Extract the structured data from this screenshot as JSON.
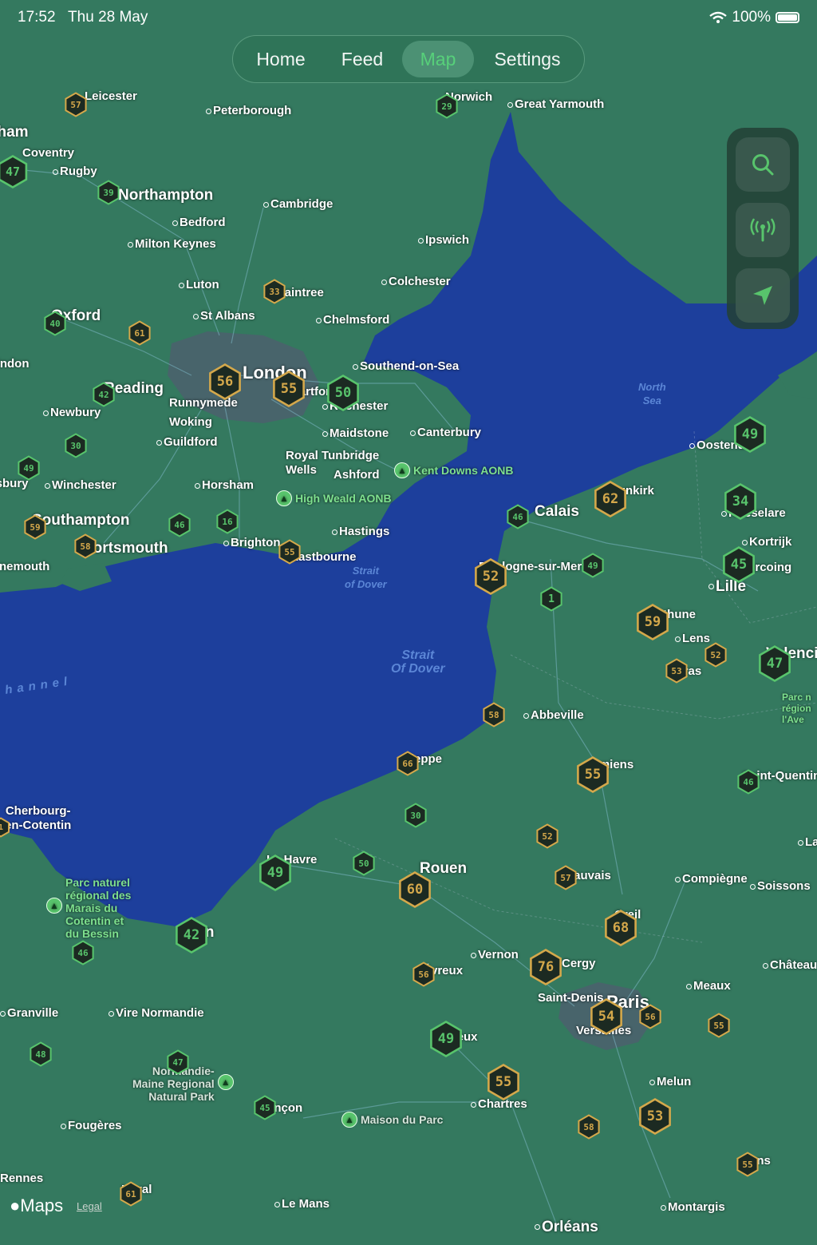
{
  "status_bar": {
    "time": "17:52",
    "date": "Thu 28 May",
    "battery": "100%"
  },
  "nav": {
    "tabs": [
      {
        "label": "Home",
        "active": false
      },
      {
        "label": "Feed",
        "active": false
      },
      {
        "label": "Map",
        "active": true
      },
      {
        "label": "Settings",
        "active": false
      }
    ]
  },
  "map_controls": [
    "search-icon",
    "antenna-icon",
    "location-arrow-icon"
  ],
  "colors": {
    "land": "#34795f",
    "sea": "#1d3f9c",
    "marker_green": "#58c46c",
    "marker_gold": "#d4a84b",
    "marker_fill": "#1c2a22"
  },
  "places": [
    {
      "id": "leicester",
      "name": "Leicester"
    },
    {
      "id": "nottingham",
      "name": "Nottingham"
    },
    {
      "id": "coventry",
      "name": "Coventry"
    },
    {
      "id": "rugby",
      "name": "Rugby"
    },
    {
      "id": "northampton",
      "name": "Northampton"
    },
    {
      "id": "peterborough",
      "name": "Peterborough"
    },
    {
      "id": "norwich",
      "name": "Norwich"
    },
    {
      "id": "great-yarmouth",
      "name": "Great Yarmouth"
    },
    {
      "id": "cambridge",
      "name": "Cambridge"
    },
    {
      "id": "bedford",
      "name": "Bedford"
    },
    {
      "id": "milton-keynes",
      "name": "Milton Keynes"
    },
    {
      "id": "ipswich",
      "name": "Ipswich"
    },
    {
      "id": "luton",
      "name": "Luton"
    },
    {
      "id": "braintree",
      "name": "Braintree"
    },
    {
      "id": "colchester",
      "name": "Colchester"
    },
    {
      "id": "oxford",
      "name": "Oxford"
    },
    {
      "id": "st-albans",
      "name": "St Albans"
    },
    {
      "id": "chelmsford",
      "name": "Chelmsford"
    },
    {
      "id": "swindon",
      "name": "Swindon"
    },
    {
      "id": "london",
      "name": "London"
    },
    {
      "id": "southend",
      "name": "Southend-on-Sea"
    },
    {
      "id": "reading",
      "name": "Reading"
    },
    {
      "id": "runnymede",
      "name": "Runnymede"
    },
    {
      "id": "dartford",
      "name": "Dartford"
    },
    {
      "id": "rochester",
      "name": "Rochester"
    },
    {
      "id": "newbury",
      "name": "Newbury"
    },
    {
      "id": "woking",
      "name": "Woking"
    },
    {
      "id": "maidstone",
      "name": "Maidstone"
    },
    {
      "id": "canterbury",
      "name": "Canterbury"
    },
    {
      "id": "guildford",
      "name": "Guildford"
    },
    {
      "id": "tunbridge-wells",
      "name": "Royal Tunbridge\nWells"
    },
    {
      "id": "ashford",
      "name": "Ashford"
    },
    {
      "id": "salisbury",
      "name": "Salisbury"
    },
    {
      "id": "winchester",
      "name": "Winchester"
    },
    {
      "id": "horsham",
      "name": "Horsham"
    },
    {
      "id": "southampton",
      "name": "Southampton"
    },
    {
      "id": "hastings",
      "name": "Hastings"
    },
    {
      "id": "portsmouth",
      "name": "Portsmouth"
    },
    {
      "id": "brighton",
      "name": "Brighton"
    },
    {
      "id": "eastbourne",
      "name": "Eastbourne"
    },
    {
      "id": "bournemouth",
      "name": "Bournemouth"
    },
    {
      "id": "oostende",
      "name": "Oostende"
    },
    {
      "id": "dunkirk",
      "name": "Dunkirk"
    },
    {
      "id": "calais",
      "name": "Calais"
    },
    {
      "id": "roeselare",
      "name": "Roeselare"
    },
    {
      "id": "kortrijk",
      "name": "Kortrijk"
    },
    {
      "id": "boulogne",
      "name": "Boulogne-sur-Mer"
    },
    {
      "id": "tourcoing",
      "name": "Tourcoing"
    },
    {
      "id": "lille",
      "name": "Lille"
    },
    {
      "id": "bethune",
      "name": "Béthune"
    },
    {
      "id": "lens",
      "name": "Lens"
    },
    {
      "id": "arras",
      "name": "Arras"
    },
    {
      "id": "valenciennes",
      "name": "Valenciennes"
    },
    {
      "id": "abbeville",
      "name": "Abbeville"
    },
    {
      "id": "dieppe",
      "name": "Dieppe"
    },
    {
      "id": "amiens",
      "name": "Amiens"
    },
    {
      "id": "saint-quentin",
      "name": "Saint-Quentin"
    },
    {
      "id": "cherbourg",
      "name": "Cherbourg-\nen-Cotentin"
    },
    {
      "id": "le-havre",
      "name": "Le Havre"
    },
    {
      "id": "rouen",
      "name": "Rouen"
    },
    {
      "id": "beauvais",
      "name": "Beauvais"
    },
    {
      "id": "compiegne",
      "name": "Compiègne"
    },
    {
      "id": "soissons",
      "name": "Soissons"
    },
    {
      "id": "laon",
      "name": "Laon"
    },
    {
      "id": "creil",
      "name": "Creil"
    },
    {
      "id": "caen",
      "name": "Caen"
    },
    {
      "id": "vernon",
      "name": "Vernon"
    },
    {
      "id": "evreux",
      "name": "Évreux"
    },
    {
      "id": "cergy",
      "name": "Cergy"
    },
    {
      "id": "chateau-thierry",
      "name": "Château"
    },
    {
      "id": "saint-denis",
      "name": "Saint-Denis"
    },
    {
      "id": "paris",
      "name": "Paris"
    },
    {
      "id": "meaux",
      "name": "Meaux"
    },
    {
      "id": "versailles",
      "name": "Versailles"
    },
    {
      "id": "granville",
      "name": "Granville"
    },
    {
      "id": "vire",
      "name": "Vire Normandie"
    },
    {
      "id": "dreux",
      "name": "Dreux"
    },
    {
      "id": "melun",
      "name": "Melun"
    },
    {
      "id": "alencon",
      "name": "Alençon"
    },
    {
      "id": "chartres",
      "name": "Chartres"
    },
    {
      "id": "fougeres",
      "name": "Fougères"
    },
    {
      "id": "rennes",
      "name": "Rennes"
    },
    {
      "id": "laval",
      "name": "Laval"
    },
    {
      "id": "le-mans",
      "name": "Le Mans"
    },
    {
      "id": "orleans",
      "name": "Orléans"
    },
    {
      "id": "montargis",
      "name": "Montargis"
    },
    {
      "id": "sens",
      "name": "Sens"
    },
    {
      "id": "gap-01",
      "name": "1"
    }
  ],
  "water_labels": [
    {
      "id": "north-sea",
      "name": "North\nSea"
    },
    {
      "id": "strait-dover-1",
      "name": "Strait\nof Dover"
    },
    {
      "id": "strait-dover-2",
      "name": "Strait\nOf Dover"
    },
    {
      "id": "english-channel",
      "name": "hannel"
    }
  ],
  "pois": [
    {
      "id": "kent-downs",
      "name": "Kent Downs AONB"
    },
    {
      "id": "high-weald",
      "name": "High Weald AONB"
    },
    {
      "id": "marais-cotentin",
      "name": "Parc naturel\nrégional des\nMarais du\nCotentin et\ndu Bessin"
    },
    {
      "id": "normandie-maine",
      "name": "Normandie-\nMaine Regional\nNatural Park"
    },
    {
      "id": "maison-parc",
      "name": "Maison du Parc"
    },
    {
      "id": "parc-avesnois",
      "name": "Parc n\nrégion\nl'Ave"
    }
  ],
  "markers": [
    {
      "id": "m1",
      "value": "57",
      "tone": "gold"
    },
    {
      "id": "m2",
      "value": "47",
      "tone": "green"
    },
    {
      "id": "m3",
      "value": "39",
      "tone": "green"
    },
    {
      "id": "m4",
      "value": "29",
      "tone": "green"
    },
    {
      "id": "m5",
      "value": "33",
      "tone": "gold"
    },
    {
      "id": "m6",
      "value": "40",
      "tone": "green"
    },
    {
      "id": "m7",
      "value": "61",
      "tone": "gold"
    },
    {
      "id": "m8",
      "value": "56",
      "tone": "gold"
    },
    {
      "id": "m9",
      "value": "55",
      "tone": "gold"
    },
    {
      "id": "m10",
      "value": "50",
      "tone": "green"
    },
    {
      "id": "m11",
      "value": "42",
      "tone": "green"
    },
    {
      "id": "m12",
      "value": "30",
      "tone": "green"
    },
    {
      "id": "m13",
      "value": "49",
      "tone": "green"
    },
    {
      "id": "m14",
      "value": "59",
      "tone": "gold"
    },
    {
      "id": "m15",
      "value": "58",
      "tone": "gold"
    },
    {
      "id": "m16",
      "value": "46",
      "tone": "green"
    },
    {
      "id": "m17",
      "value": "16",
      "tone": "green"
    },
    {
      "id": "m18",
      "value": "55",
      "tone": "gold"
    },
    {
      "id": "m19",
      "value": "49",
      "tone": "green"
    },
    {
      "id": "m20",
      "value": "62",
      "tone": "gold"
    },
    {
      "id": "m21",
      "value": "34",
      "tone": "green"
    },
    {
      "id": "m22",
      "value": "46",
      "tone": "green"
    },
    {
      "id": "m23",
      "value": "52",
      "tone": "gold"
    },
    {
      "id": "m24",
      "value": "49",
      "tone": "green"
    },
    {
      "id": "m25",
      "value": "45",
      "tone": "green"
    },
    {
      "id": "m26",
      "value": "1",
      "tone": "green"
    },
    {
      "id": "m27",
      "value": "59",
      "tone": "gold"
    },
    {
      "id": "m28",
      "value": "52",
      "tone": "gold"
    },
    {
      "id": "m29",
      "value": "53",
      "tone": "gold"
    },
    {
      "id": "m30",
      "value": "47",
      "tone": "green"
    },
    {
      "id": "m31",
      "value": "58",
      "tone": "gold"
    },
    {
      "id": "m32",
      "value": "66",
      "tone": "gold"
    },
    {
      "id": "m33",
      "value": "55",
      "tone": "gold"
    },
    {
      "id": "m34",
      "value": "46",
      "tone": "green"
    },
    {
      "id": "m35",
      "value": "30",
      "tone": "green"
    },
    {
      "id": "m36",
      "value": "52",
      "tone": "gold"
    },
    {
      "id": "m37",
      "value": "49",
      "tone": "green"
    },
    {
      "id": "m38",
      "value": "50",
      "tone": "green"
    },
    {
      "id": "m39",
      "value": "60",
      "tone": "gold"
    },
    {
      "id": "m40",
      "value": "57",
      "tone": "gold"
    },
    {
      "id": "m41",
      "value": "68",
      "tone": "gold"
    },
    {
      "id": "m42",
      "value": "42",
      "tone": "green"
    },
    {
      "id": "m43",
      "value": "46",
      "tone": "green"
    },
    {
      "id": "m44",
      "value": "76",
      "tone": "gold"
    },
    {
      "id": "m45",
      "value": "56",
      "tone": "gold"
    },
    {
      "id": "m46",
      "value": "54",
      "tone": "gold"
    },
    {
      "id": "m47",
      "value": "56",
      "tone": "gold"
    },
    {
      "id": "m48",
      "value": "55",
      "tone": "gold"
    },
    {
      "id": "m49",
      "value": "49",
      "tone": "green"
    },
    {
      "id": "m50",
      "value": "48",
      "tone": "green"
    },
    {
      "id": "m51",
      "value": "47",
      "tone": "green"
    },
    {
      "id": "m52",
      "value": "45",
      "tone": "green"
    },
    {
      "id": "m53",
      "value": "55",
      "tone": "gold"
    },
    {
      "id": "m54",
      "value": "58",
      "tone": "gold"
    },
    {
      "id": "m55",
      "value": "53",
      "tone": "gold"
    },
    {
      "id": "m56",
      "value": "55",
      "tone": "gold"
    },
    {
      "id": "m57",
      "value": "61",
      "tone": "gold"
    },
    {
      "id": "m58",
      "value": "1",
      "tone": "gold"
    }
  ],
  "attribution": {
    "brand": "Maps",
    "legal": "Legal"
  }
}
